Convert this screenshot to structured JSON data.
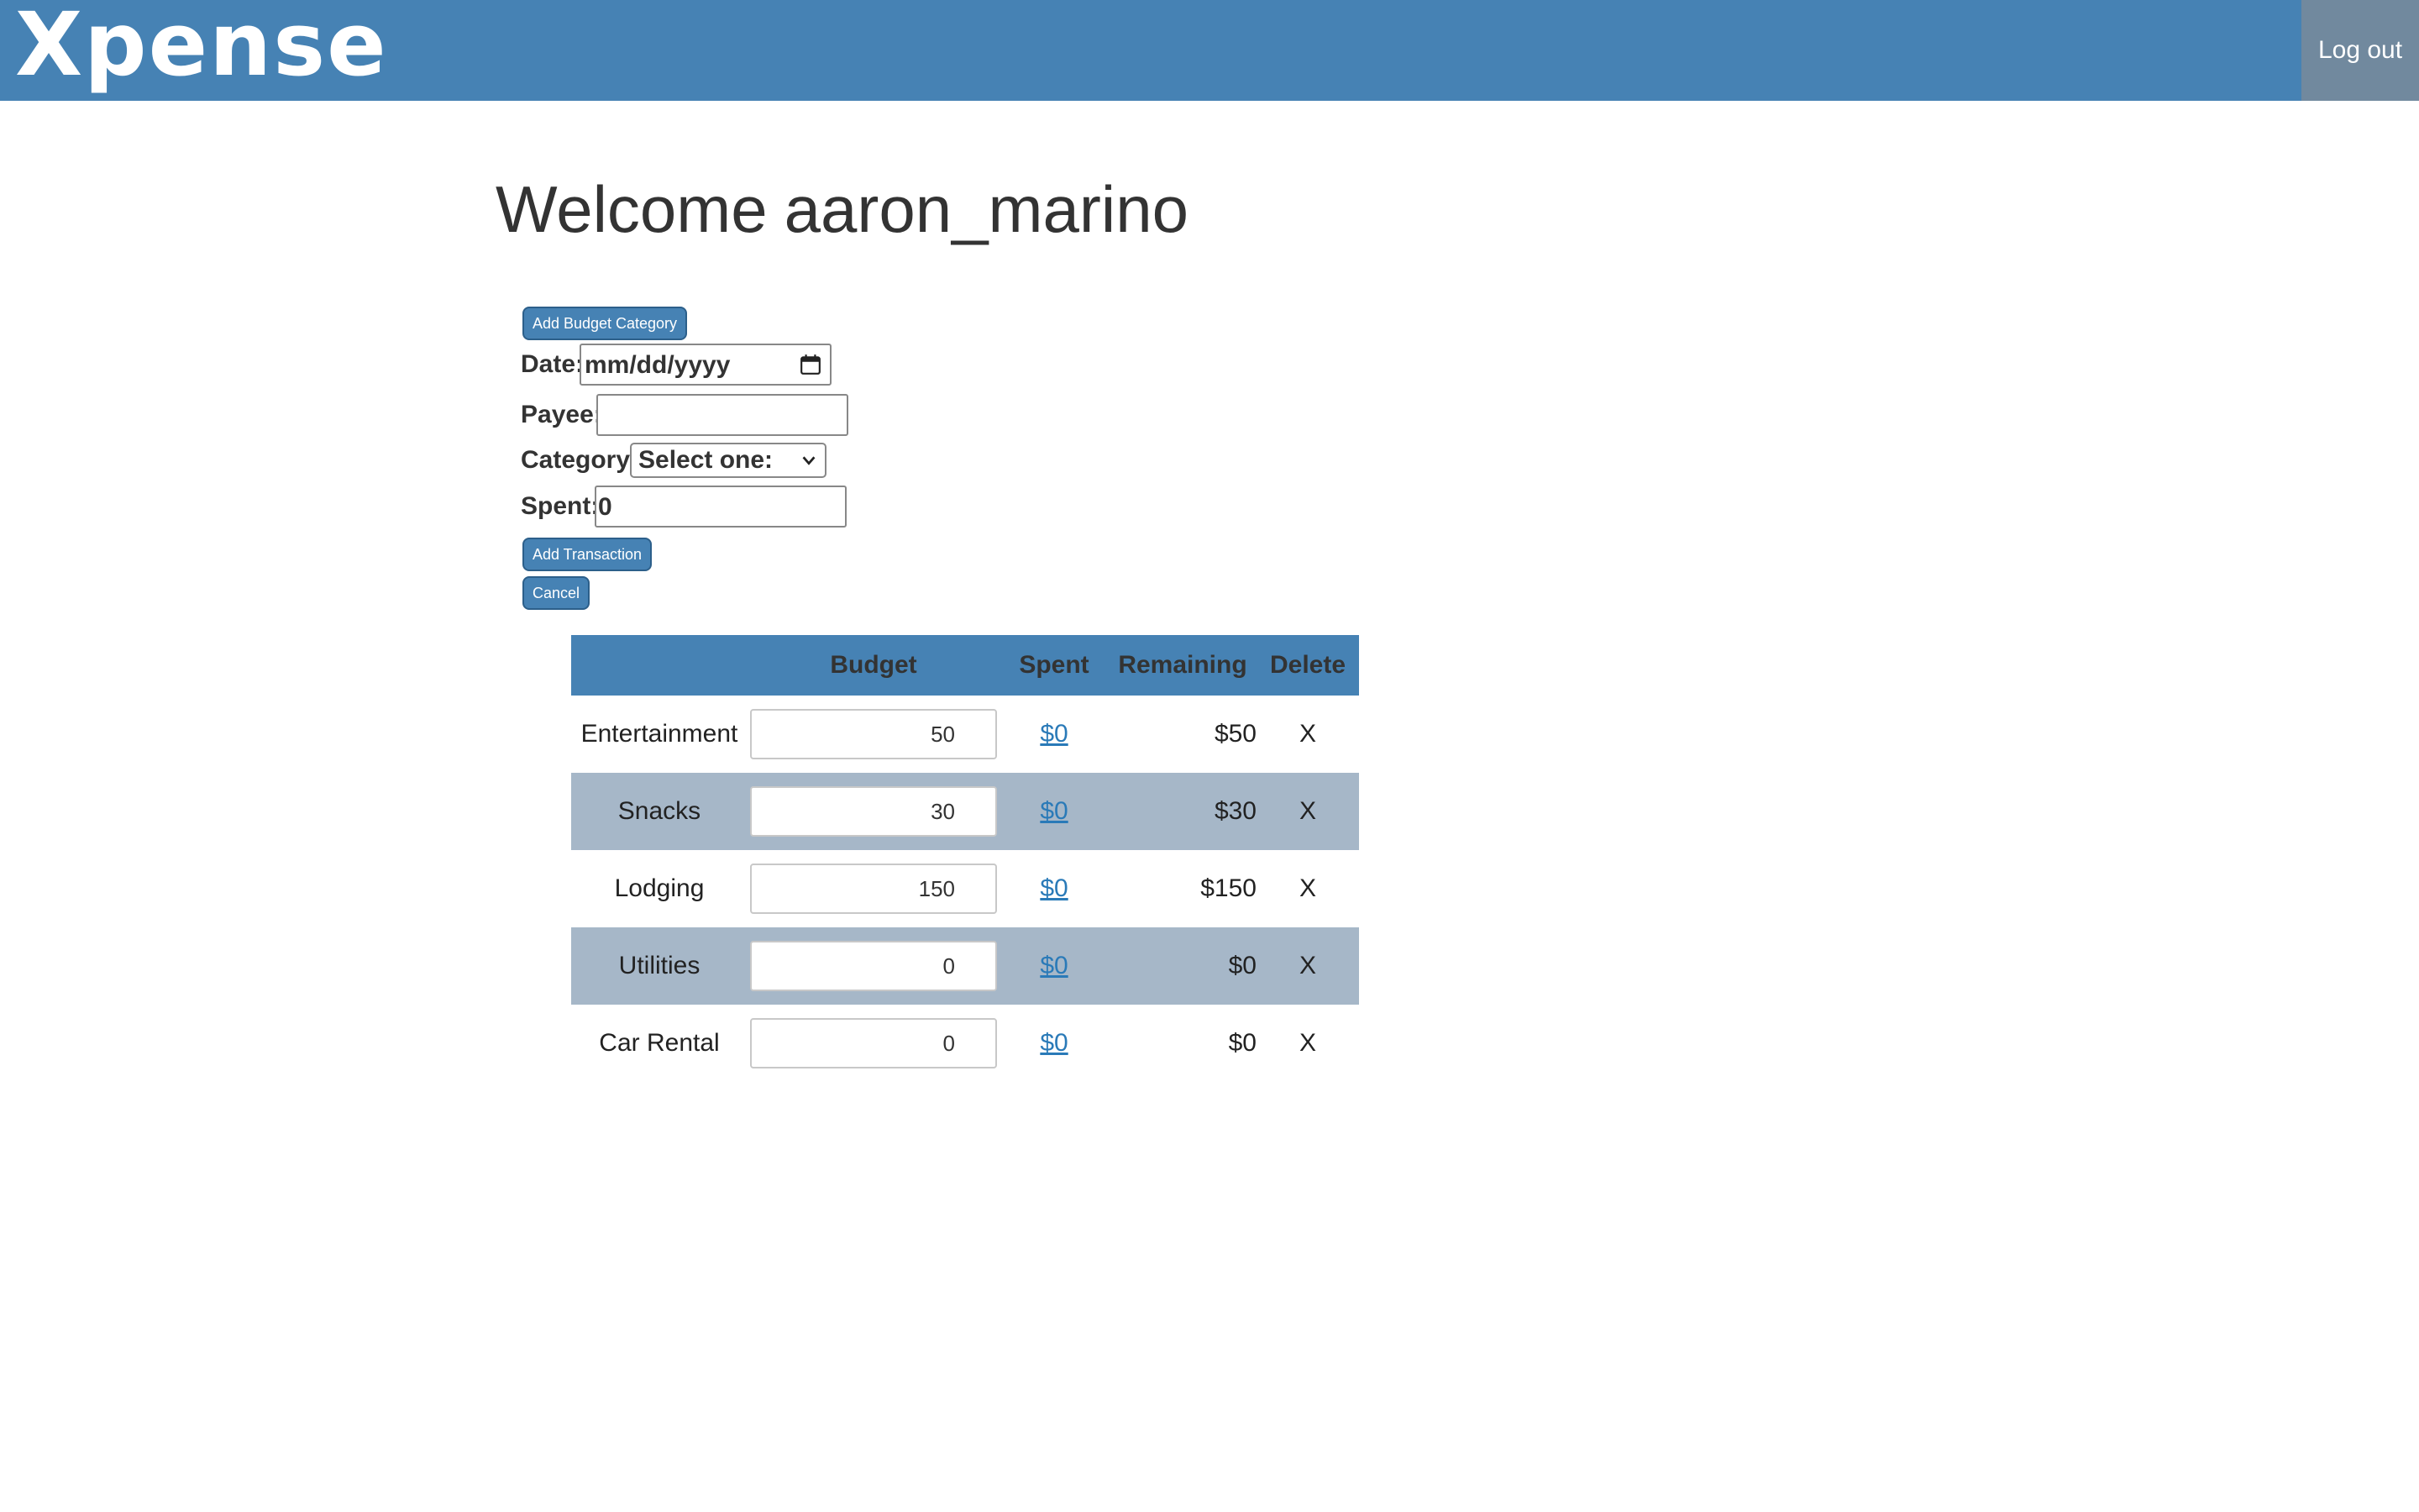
{
  "navbar": {
    "logo": "Xpense",
    "logout_label": "Log out"
  },
  "welcome": {
    "greeting": "Welcome",
    "username": "aaron_marino"
  },
  "form": {
    "add_category_label": "Add Budget Category",
    "date_label": "Date:",
    "date_placeholder": "mm/dd/yyyy",
    "payee_label": "Payee:",
    "payee_value": "",
    "category_label": "Category:",
    "category_selected": "Select one:",
    "spent_label": "Spent:",
    "spent_value": "0",
    "add_transaction_label": "Add Transaction",
    "cancel_label": "Cancel"
  },
  "table": {
    "headers": {
      "category": "",
      "budget": "Budget",
      "spent": "Spent",
      "remaining": "Remaining",
      "delete": "Delete"
    },
    "rows": [
      {
        "category": "Entertainment",
        "budget": "50",
        "spent": "$0",
        "remaining": "$50",
        "delete": "X"
      },
      {
        "category": "Snacks",
        "budget": "30",
        "spent": "$0",
        "remaining": "$30",
        "delete": "X"
      },
      {
        "category": "Lodging",
        "budget": "150",
        "spent": "$0",
        "remaining": "$150",
        "delete": "X"
      },
      {
        "category": "Utilities",
        "budget": "0",
        "spent": "$0",
        "remaining": "$0",
        "delete": "X"
      },
      {
        "category": "Car Rental",
        "budget": "0",
        "spent": "$0",
        "remaining": "$0",
        "delete": "X"
      }
    ]
  },
  "colors": {
    "navbar": "#4682b4",
    "logout_bg": "#71899e",
    "row_alt": "#a6b7c8",
    "link": "#2a7ab8"
  },
  "icons": {
    "date": "calendar-icon",
    "select": "chevron-down-icon"
  }
}
